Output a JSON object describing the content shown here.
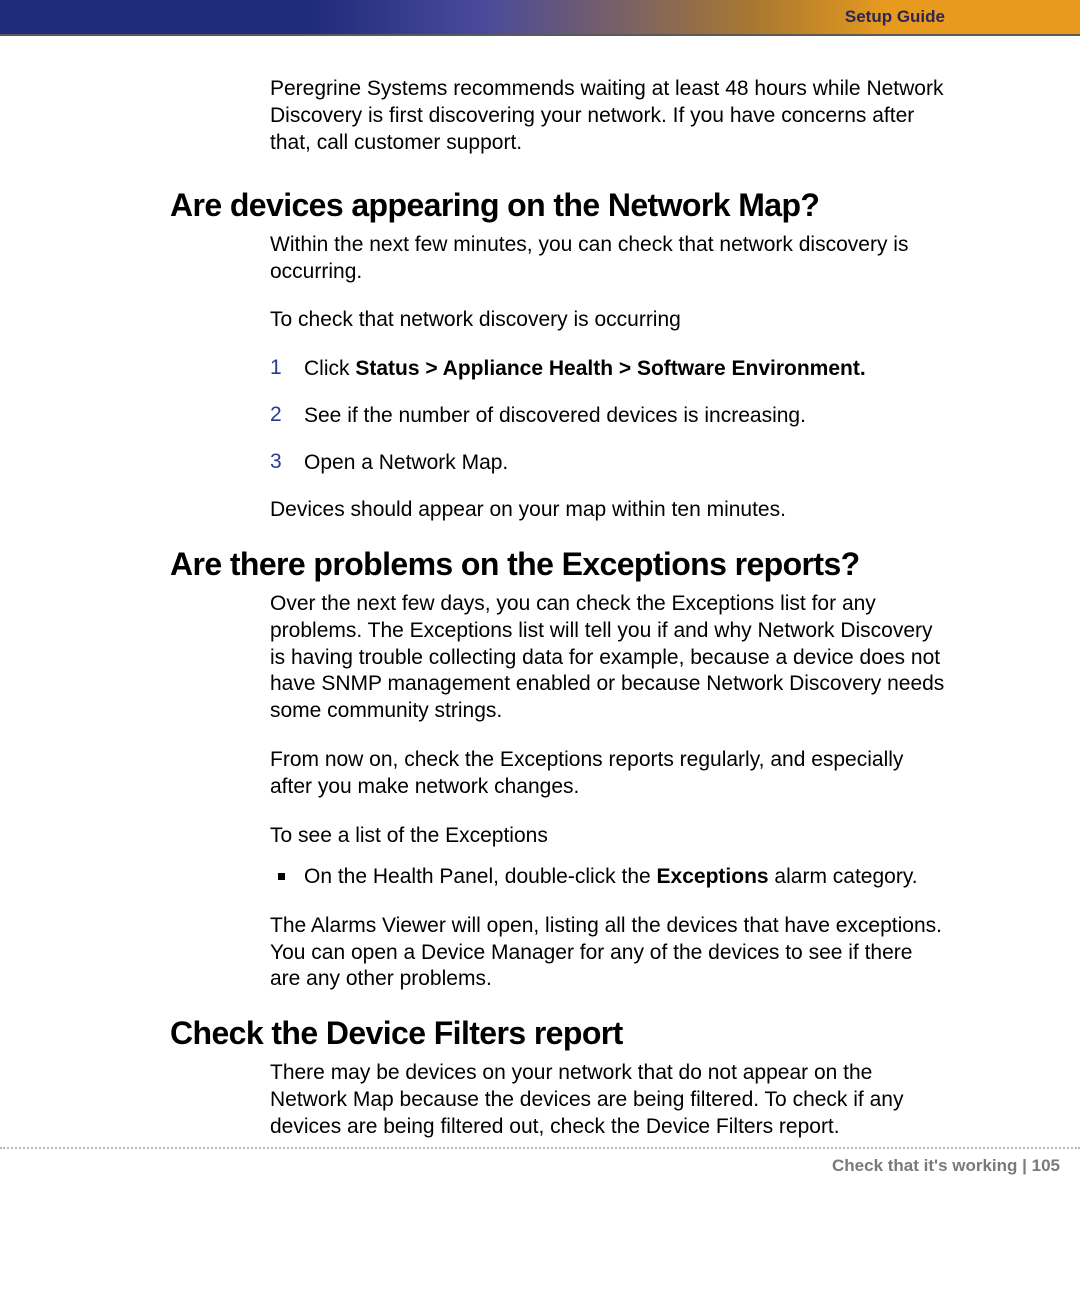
{
  "header": {
    "label": "Setup Guide"
  },
  "intro": "Peregrine Systems recommends waiting at least 48 hours while Network Discovery is first discovering your network. If you have concerns after that, call customer support.",
  "section1": {
    "title": "Are devices appearing on the Network Map?",
    "p1": "Within the next few minutes, you can check that network discovery is occurring.",
    "p2": "To check that network discovery is occurring",
    "steps": {
      "n1": "1",
      "t1a": "Click ",
      "t1b": "Status > Appliance Health > Software Environment.",
      "n2": "2",
      "t2": "See if the number of discovered devices is increasing.",
      "n3": "3",
      "t3": "Open a Network Map."
    },
    "p3": "Devices should appear on your map within ten minutes."
  },
  "section2": {
    "title": "Are there problems on the Exceptions reports?",
    "p1": "Over the next few days, you can check the Exceptions list for any problems. The Exceptions list will tell you if and why Network Discovery is having trouble collecting data for example, because a device does not have SNMP management enabled or because Network Discovery needs some community strings.",
    "p2": "From now on, check the Exceptions reports regularly, and especially after you make network changes.",
    "p3": "To see a list of the Exceptions",
    "bullet": {
      "a": "On the Health Panel, double-click the ",
      "b": "Exceptions",
      "c": " alarm category."
    },
    "p4": "The Alarms Viewer will open, listing all the devices that have exceptions. You can open a Device Manager for any of the devices to see if there are any other problems."
  },
  "section3": {
    "title": "Check the Device Filters report",
    "p1": "There may be devices on your network that do not appear on the Network Map because the devices are being filtered. To check if any devices are being filtered out, check the Device Filters report."
  },
  "footer": {
    "chapter": "Check that it's working",
    "sep": " | ",
    "page": "105"
  }
}
